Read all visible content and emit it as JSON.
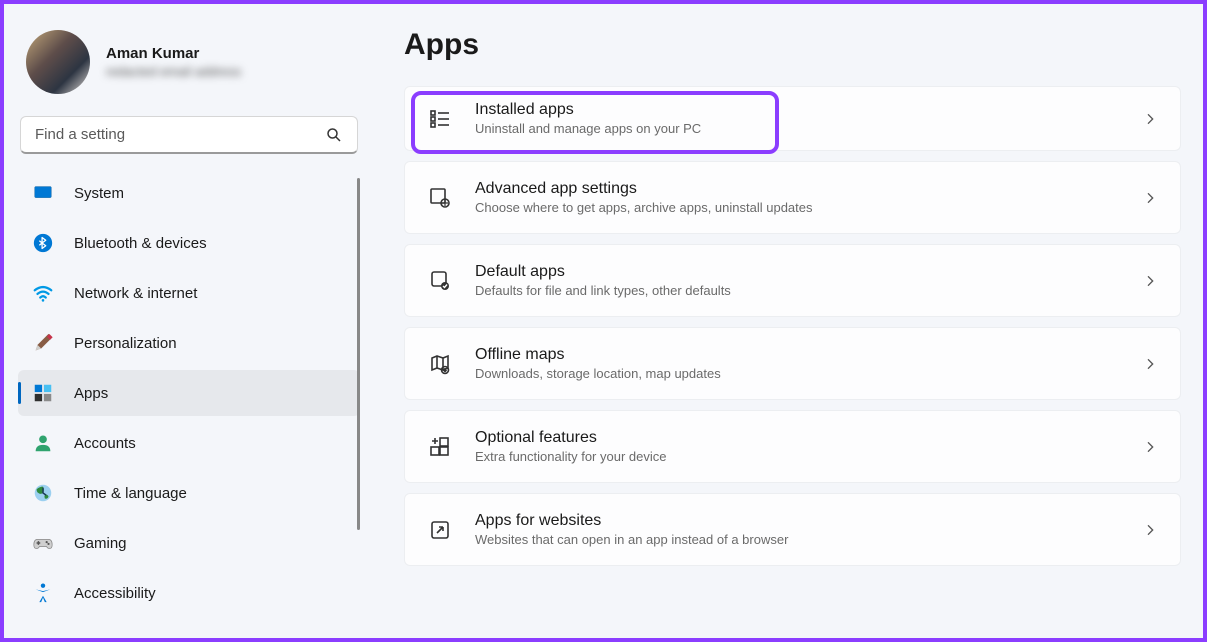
{
  "profile": {
    "name": "Aman Kumar",
    "email": "redacted email address"
  },
  "search": {
    "placeholder": "Find a setting"
  },
  "sidebar": {
    "items": [
      {
        "icon": "system",
        "label": "System",
        "active": false
      },
      {
        "icon": "bluetooth",
        "label": "Bluetooth & devices",
        "active": false
      },
      {
        "icon": "network",
        "label": "Network & internet",
        "active": false
      },
      {
        "icon": "personalization",
        "label": "Personalization",
        "active": false
      },
      {
        "icon": "apps",
        "label": "Apps",
        "active": true
      },
      {
        "icon": "accounts",
        "label": "Accounts",
        "active": false
      },
      {
        "icon": "time",
        "label": "Time & language",
        "active": false
      },
      {
        "icon": "gaming",
        "label": "Gaming",
        "active": false
      },
      {
        "icon": "accessibility",
        "label": "Accessibility",
        "active": false
      }
    ]
  },
  "page": {
    "title": "Apps"
  },
  "cards": [
    {
      "icon": "installed-apps",
      "title": "Installed apps",
      "desc": "Uninstall and manage apps on your PC",
      "highlight": true
    },
    {
      "icon": "advanced",
      "title": "Advanced app settings",
      "desc": "Choose where to get apps, archive apps, uninstall updates"
    },
    {
      "icon": "default-apps",
      "title": "Default apps",
      "desc": "Defaults for file and link types, other defaults"
    },
    {
      "icon": "offline-maps",
      "title": "Offline maps",
      "desc": "Downloads, storage location, map updates"
    },
    {
      "icon": "optional",
      "title": "Optional features",
      "desc": "Extra functionality for your device"
    },
    {
      "icon": "websites",
      "title": "Apps for websites",
      "desc": "Websites that can open in an app instead of a browser"
    }
  ]
}
